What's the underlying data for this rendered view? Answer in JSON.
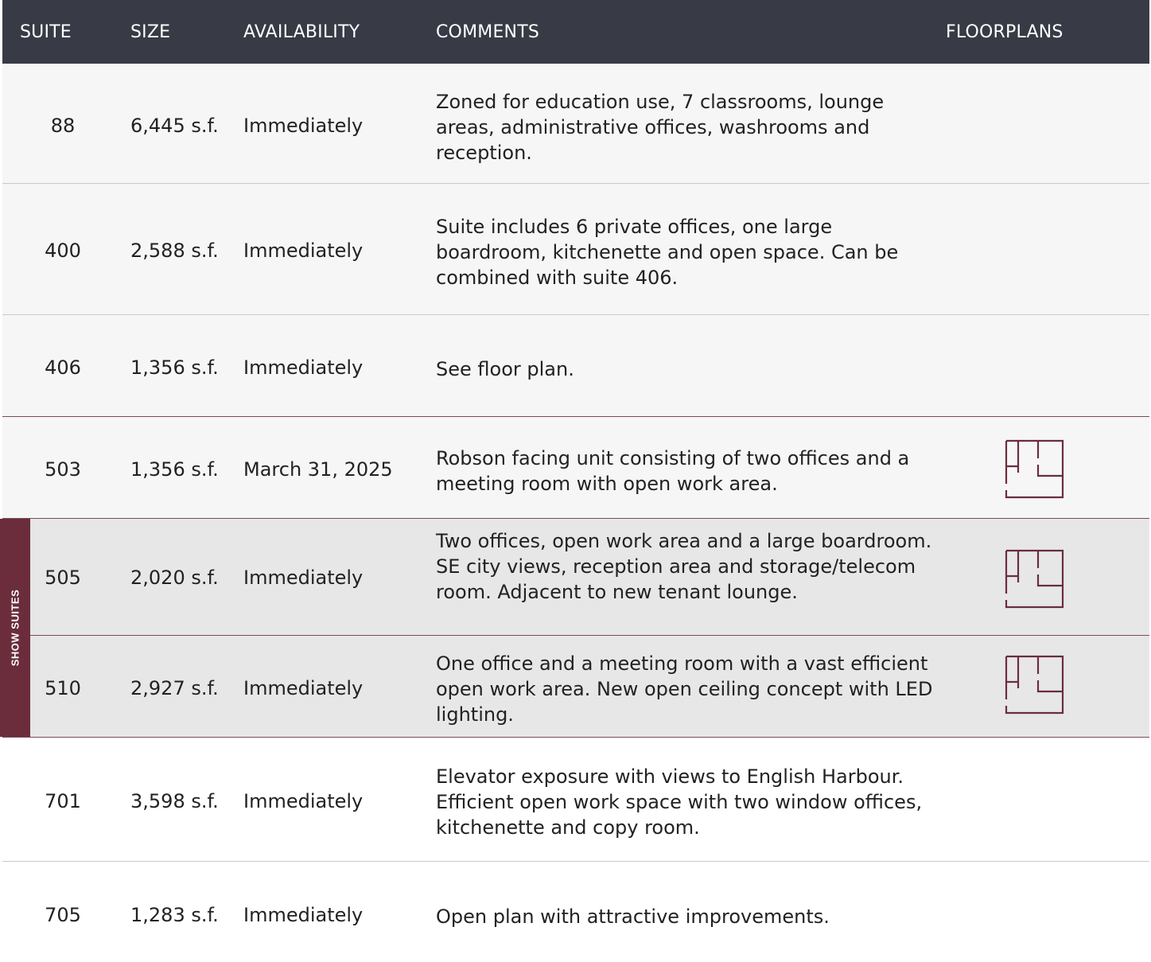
{
  "columns": {
    "suite": "SUITE",
    "size": "SIZE",
    "availability": "AVAILABILITY",
    "comments": "COMMENTS",
    "floorplans": "FLOORPLANS"
  },
  "show_suites_label": "SHOW SUITES",
  "rows": [
    {
      "suite": "88",
      "size": "6,445 s.f.",
      "availability": "Immediately",
      "comments": "Zoned for education use, 7 classrooms, lounge areas, administrative offices, washrooms and reception.",
      "floorplan": false
    },
    {
      "suite": "400",
      "size": "2,588 s.f.",
      "availability": "Immediately",
      "comments": "Suite includes 6 private offices, one large boardroom, kitchenette and open space. Can be combined with suite 406.",
      "floorplan": false
    },
    {
      "suite": "406",
      "size": "1,356 s.f.",
      "availability": "Immediately",
      "comments": "See floor plan.",
      "floorplan": false
    },
    {
      "suite": "503",
      "size": "1,356 s.f.",
      "availability": "March 31, 2025",
      "comments": "Robson facing unit consisting of two offices and a meeting room with open work area.",
      "floorplan": true
    },
    {
      "suite": "505",
      "size": "2,020 s.f.",
      "availability": "Immediately",
      "comments": "Two offices, open work area and a large boardroom. SE city views, reception area and storage/telecom room. Adjacent to new tenant lounge.",
      "floorplan": true
    },
    {
      "suite": "510",
      "size": "2,927 s.f.",
      "availability": "Immediately",
      "comments": "One office and a meeting room with a vast efficient open work area. New open ceiling concept with LED lighting.",
      "floorplan": true
    },
    {
      "suite": "701",
      "size": "3,598 s.f.",
      "availability": "Immediately",
      "comments": "Elevator exposure with views to English Harbour. Efficient open work space with two window offices, kitchenette and copy room.",
      "floorplan": false
    },
    {
      "suite": "705",
      "size": "1,283 s.f.",
      "availability": "Immediately",
      "comments": "Open plan with attractive improvements.",
      "floorplan": false
    }
  ],
  "colors": {
    "header_bg": "#383b45",
    "accent": "#6b2d3c",
    "show_row_bg": "#e7e7e7",
    "alt_row_bg": "#f6f6f6"
  },
  "icons": {
    "floorplan": "floorplan-icon"
  }
}
